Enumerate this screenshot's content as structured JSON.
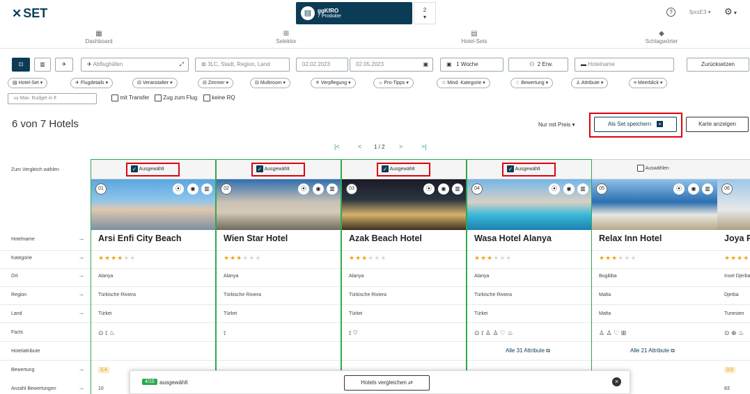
{
  "app": {
    "logo": "SET"
  },
  "products": {
    "title": "ggKfRO",
    "subtitle": "7 Produkte",
    "count": "2"
  },
  "user": {
    "name": "fpxsE3"
  },
  "nav": [
    {
      "label": "Dashboard",
      "icon": "dashboard-icon"
    },
    {
      "label": "Selektor",
      "icon": "grid-icon"
    },
    {
      "label": "Hotel-Sets",
      "icon": "list-icon"
    },
    {
      "label": "Schlagwörter",
      "icon": "tag-icon"
    }
  ],
  "search": {
    "airport_placeholder": "Abflughäfen",
    "destination_placeholder": "3LC, Stadt, Region, Land",
    "date_from": "02.02.2023",
    "date_to": "02.05.2023",
    "duration": "1 Woche",
    "travellers": "2 Erw.",
    "hotel_placeholder": "Hotelname",
    "reset": "Zurücksetzen",
    "budget_placeholder": "Max. Budget in €"
  },
  "pills": [
    "Hotel-Set",
    "Flugdetails",
    "Veranstalter",
    "Zimmer",
    "Multiroom",
    "Verpflegung",
    "Pro-Tipps",
    "Mind. Kategorie",
    "Bewertung",
    "Attribute",
    "Meerblick"
  ],
  "checks": [
    "mit Transfer",
    "Zug zum Flug",
    "keine RQ"
  ],
  "result": {
    "title": "6 von 7 Hotels",
    "sort": "Nur mit Preis",
    "save_set": "Als Set speichern",
    "map": "Karte anzeigen"
  },
  "pager": {
    "text": "1 / 2"
  },
  "row_labels": {
    "compare": "Zum Vergleich wählen",
    "hotelname": "Hotelname",
    "kategorie": "Kategorie",
    "ort": "Ort",
    "region": "Region",
    "land": "Land",
    "facts": "Facts",
    "hotelattribute": "Hotelattribute",
    "bewertung": "Bewertung",
    "anzahl": "Anzahl Bewertungen"
  },
  "hotels": [
    {
      "num": "01",
      "name": "Arsi Enfi City Beach",
      "stars": 4,
      "ort": "Alanya",
      "region": "Türkische Riviera",
      "land": "Türkei",
      "facts": "⊙ ⟟ ♨",
      "select": "Ausgewählt",
      "selected": true,
      "attributes": "",
      "rating": "3,4",
      "count": "10"
    },
    {
      "num": "02",
      "name": "Wien Star Hotel",
      "stars": 3,
      "ort": "Alanya",
      "region": "Türkische Riviera",
      "land": "Türkei",
      "facts": "⟟",
      "select": "Ausgewählt",
      "selected": true,
      "attributes": "",
      "rating": "",
      "count": ""
    },
    {
      "num": "03",
      "name": "Azak Beach Hotel",
      "stars": 3,
      "ort": "Alanya",
      "region": "Türkische Riviera",
      "land": "Türkei",
      "facts": "⟟ ♡",
      "select": "Ausgewählt",
      "selected": true,
      "attributes": "",
      "rating": "",
      "count": ""
    },
    {
      "num": "04",
      "name": "Wasa Hotel Alanya",
      "stars": 3,
      "ort": "Alanya",
      "region": "Türkische Riviera",
      "land": "Türkei",
      "facts": "⊙ ⟟ ♙ ♙ ♡ ♨",
      "select": "Ausgewählt",
      "selected": true,
      "attributes": "Alle 31 Attribute",
      "rating": "",
      "count": ""
    },
    {
      "num": "05",
      "name": "Relax Inn Hotel",
      "stars": 3,
      "ort": "Bugibba",
      "region": "Malta",
      "land": "Malta",
      "facts": "♙ ♙ ♡ ⊞",
      "select": "Auswählen",
      "selected": false,
      "attributes": "Alle 21 Attribute",
      "rating": "",
      "count": ""
    },
    {
      "num": "06",
      "name": "Joya P",
      "stars": 4,
      "ort": "Insel Djerba",
      "region": "Djerba",
      "land": "Tunesien",
      "facts": "⊙ ⊕ ♨",
      "select": "",
      "selected": false,
      "attributes": "",
      "rating": "3,0",
      "count": "83"
    }
  ],
  "bottom": {
    "badge": "4/10",
    "text": "ausgewählt",
    "compare": "Hotels vergleichen"
  },
  "colors": {
    "brand": "#0b3b55",
    "selected": "#2fa84f",
    "highlight": "#e0000c",
    "star": "#f2a516"
  }
}
